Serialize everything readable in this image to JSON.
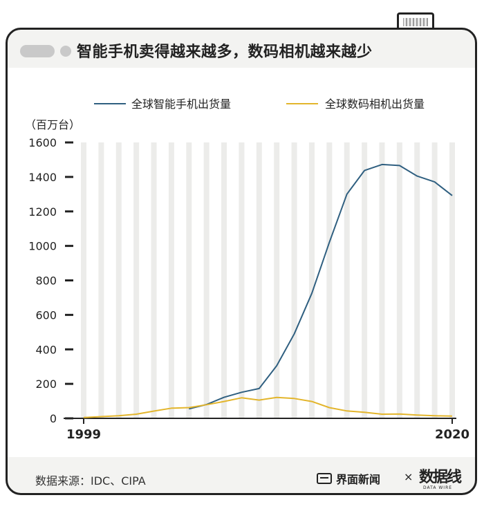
{
  "title": "智能手机卖得越来越多，数码相机越来越少",
  "footer": {
    "source": "数据来源：IDC、CIPA",
    "brand": "界面新闻",
    "times": "×",
    "logo": "数据线",
    "logo_sub": "DATA WIRE"
  },
  "colors": {
    "smartphone": "#2f5f80",
    "camera": "#e3b52b",
    "grid_band": "#ececea"
  },
  "chart_data": {
    "type": "line",
    "ylabel": "（百万台）",
    "ylim": [
      0,
      1600
    ],
    "yticks": [
      "0",
      "200",
      "400",
      "600",
      "800",
      "1000",
      "1200",
      "1400",
      "1600"
    ],
    "x": [
      1999,
      2000,
      2001,
      2002,
      2003,
      2004,
      2005,
      2006,
      2007,
      2008,
      2009,
      2010,
      2011,
      2012,
      2013,
      2014,
      2015,
      2016,
      2017,
      2018,
      2019,
      2020
    ],
    "xtick_labels": [
      {
        "year": 1999,
        "label": "1999"
      },
      {
        "year": 2020,
        "label": "2020"
      }
    ],
    "series": [
      {
        "name": "全球智能手机出货量",
        "color": "#2f5f80",
        "values": [
          null,
          null,
          null,
          null,
          null,
          null,
          55,
          80,
          122,
          151,
          173,
          305,
          490,
          725,
          1020,
          1300,
          1437,
          1472,
          1466,
          1405,
          1371,
          1292
        ]
      },
      {
        "name": "全球数码相机出货量",
        "color": "#e3b52b",
        "values": [
          5,
          10,
          15,
          24,
          42,
          59,
          62,
          79,
          98,
          119,
          106,
          121,
          115,
          98,
          62,
          43,
          35,
          24,
          25,
          19,
          15,
          13
        ]
      }
    ],
    "legend_position": "top",
    "grid": "vertical bands"
  }
}
